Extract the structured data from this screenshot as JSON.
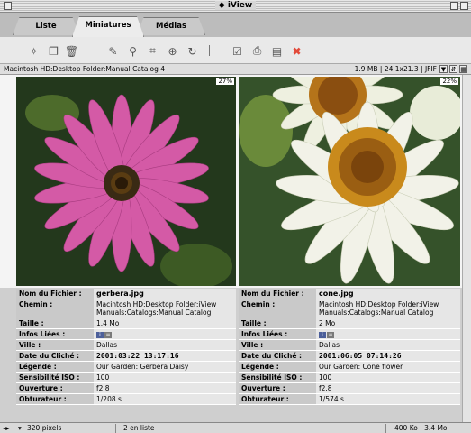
{
  "window": {
    "title": "iView"
  },
  "tabs": [
    {
      "label": "Liste",
      "active": false
    },
    {
      "label": "Miniatures",
      "active": true
    },
    {
      "label": "Médias",
      "active": false
    }
  ],
  "toolbar_icons": [
    "wand-icon",
    "copy-icon",
    "trash-icon",
    "edit-icon",
    "image-add-icon",
    "crop-icon",
    "zoom-icon",
    "rotate-icon",
    "checkbox-icon",
    "print-icon",
    "folder-icon",
    "stop-icon"
  ],
  "path_bar": {
    "path": "Macintosh HD:Desktop Folder:Manual Catalog 4",
    "meta": "1.9 MB  |  24.1x21.3  |  JFIF"
  },
  "images": [
    {
      "zoom": "27%",
      "colors": {
        "petal": "#d45aa6",
        "center": "#3a2a14"
      },
      "info": {
        "nom": "gerbera.jpg",
        "chemin": "Macintosh HD:Desktop Folder:iView Manuals:Catalogs:Manual Catalog",
        "taille": "1.4 Mo",
        "ville": "Dallas",
        "date": "2001:03:22 13:17:16",
        "legende": "Our Garden: Gerbera Daisy",
        "iso": "100",
        "ouverture": "f2.8",
        "obturateur": "1/208 s"
      }
    },
    {
      "zoom": "22%",
      "colors": {
        "petal": "#f2f2e8",
        "center": "#c98a1c"
      },
      "info": {
        "nom": "cone.jpg",
        "chemin": "Macintosh HD:Desktop Folder:iView Manuals:Catalogs:Manual Catalog",
        "taille": "2 Mo",
        "ville": "Dallas",
        "date": "2001:06:05 07:14:26",
        "legende": "Our Garden: Cone flower",
        "iso": "100",
        "ouverture": "f2.8",
        "obturateur": "1/574 s"
      }
    }
  ],
  "labels": {
    "nom": "Nom du Fichier :",
    "chemin": "Chemin :",
    "taille": "Taille :",
    "infos": "Infos Liées :",
    "ville": "Ville :",
    "date": "Date du Cliché :",
    "legende": "Légende :",
    "iso": "Sensibilité ISO :",
    "ouverture": "Ouverture :",
    "obturateur": "Obturateur :"
  },
  "status": {
    "zoom": "320 pixels",
    "count": "2 en liste",
    "size": "400 Ko  |  3.4 Mo"
  }
}
